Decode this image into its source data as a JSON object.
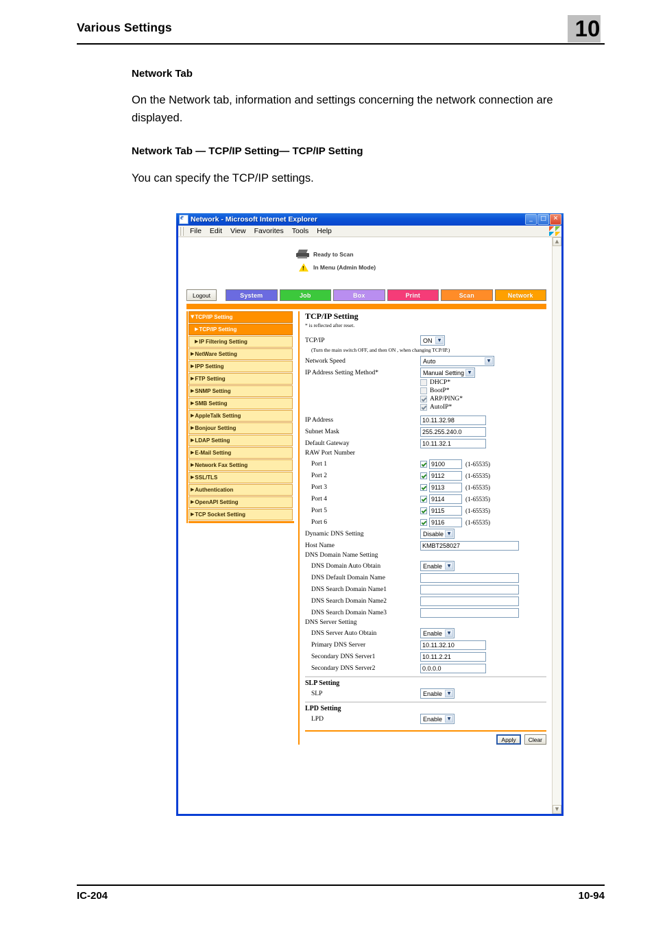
{
  "page": {
    "running_head": "Various Settings",
    "chapter_number": "10",
    "footer_left": "IC-204",
    "footer_right": "10-94"
  },
  "doc": {
    "heading1": "Network Tab",
    "para1": "On the Network tab, information and settings concerning the network connection are displayed.",
    "heading2": "Network Tab — TCP/IP Setting— TCP/IP Setting",
    "para2": "You can specify the TCP/IP settings."
  },
  "browser": {
    "title": "Network - Microsoft Internet Explorer",
    "icon": "ie-document-icon",
    "window_buttons": [
      {
        "name": "minimize",
        "glyph": "_"
      },
      {
        "name": "maximize",
        "glyph": "□"
      },
      {
        "name": "close",
        "glyph": "✕"
      }
    ],
    "menu": [
      "File",
      "Edit",
      "View",
      "Favorites",
      "Tools",
      "Help"
    ]
  },
  "webpage": {
    "status": [
      {
        "icon": "printer-icon",
        "text": "Ready to Scan"
      },
      {
        "icon": "warning-icon",
        "text": "In Menu (Admin Mode)"
      }
    ],
    "logout_label": "Logout",
    "tabs": [
      {
        "label": "System",
        "color": "#6b6be0"
      },
      {
        "label": "Job",
        "color": "#3cc83c"
      },
      {
        "label": "Box",
        "color": "#b98ef0"
      },
      {
        "label": "Print",
        "color": "#f53c78"
      },
      {
        "label": "Scan",
        "color": "#ff8c28"
      },
      {
        "label": "Network",
        "color": "#ffa000"
      }
    ],
    "accent_color": "#ff9000",
    "sidebar": [
      {
        "label": "TCP/IP Setting",
        "state": "group",
        "marker": "▼"
      },
      {
        "label": "TCP/IP Setting",
        "state": "active",
        "marker": "▶",
        "indent": true
      },
      {
        "label": "IP Filtering Setting",
        "state": "normal",
        "marker": "▶",
        "indent": true
      },
      {
        "label": "NetWare Setting",
        "state": "normal",
        "marker": "▶"
      },
      {
        "label": "IPP Setting",
        "state": "normal",
        "marker": "▶"
      },
      {
        "label": "FTP Setting",
        "state": "normal",
        "marker": "▶"
      },
      {
        "label": "SNMP Setting",
        "state": "normal",
        "marker": "▶"
      },
      {
        "label": "SMB Setting",
        "state": "normal",
        "marker": "▶"
      },
      {
        "label": "AppleTalk Setting",
        "state": "normal",
        "marker": "▶"
      },
      {
        "label": "Bonjour Setting",
        "state": "normal",
        "marker": "▶"
      },
      {
        "label": "LDAP Setting",
        "state": "normal",
        "marker": "▶"
      },
      {
        "label": "E-Mail Setting",
        "state": "normal",
        "marker": "▶"
      },
      {
        "label": "Network Fax Setting",
        "state": "normal",
        "marker": "▶"
      },
      {
        "label": "SSL/TLS",
        "state": "normal",
        "marker": "▶"
      },
      {
        "label": "Authentication",
        "state": "normal",
        "marker": "▶"
      },
      {
        "label": "OpenAPI Setting",
        "state": "normal",
        "marker": "▶"
      },
      {
        "label": "TCP Socket Setting",
        "state": "normal",
        "marker": "▶"
      }
    ],
    "content": {
      "title": "TCP/IP Setting",
      "note": "* is reflected after reset.",
      "tcpip_label": "TCP/IP",
      "tcpip_value": "ON",
      "tcpip_hint": "(Turn the main switch OFF, and then ON , when changing TCP/IP.)",
      "network_speed_label": "Network Speed",
      "network_speed_value": "Auto",
      "ip_method_label": "IP Address Setting Method*",
      "ip_method_value": "Manual Setting",
      "ip_method_options": [
        {
          "label": "DHCP*",
          "checked": false,
          "disabled": true
        },
        {
          "label": "BootP*",
          "checked": false,
          "disabled": true
        },
        {
          "label": "ARP/PING*",
          "checked": true,
          "disabled": true
        },
        {
          "label": "AutoIP*",
          "checked": true,
          "disabled": true
        }
      ],
      "ip_address_label": "IP Address",
      "ip_address_value": "10.11.32.98",
      "subnet_label": "Subnet Mask",
      "subnet_value": "255.255.240.0",
      "gateway_label": "Default Gateway",
      "gateway_value": "10.11.32.1",
      "raw_port_label": "RAW Port Number",
      "port_range": "(1-65535)",
      "ports": [
        {
          "label": "Port 1",
          "value": "9100",
          "checked": true
        },
        {
          "label": "Port 2",
          "value": "9112",
          "checked": true
        },
        {
          "label": "Port 3",
          "value": "9113",
          "checked": true
        },
        {
          "label": "Port 4",
          "value": "9114",
          "checked": true
        },
        {
          "label": "Port 5",
          "value": "9115",
          "checked": true
        },
        {
          "label": "Port 6",
          "value": "9116",
          "checked": true
        }
      ],
      "dyndns_label": "Dynamic DNS Setting",
      "dyndns_value": "Disable",
      "hostname_label": "Host Name",
      "hostname_value": "KMBT258027",
      "dns_domain_section": "DNS Domain Name Setting",
      "dns_domain_auto_label": "DNS Domain Auto Obtain",
      "dns_domain_auto_value": "Enable",
      "dns_default_domain_label": "DNS Default Domain Name",
      "dns_default_domain_value": "",
      "dns_search1_label": "DNS Search Domain Name1",
      "dns_search1_value": "",
      "dns_search2_label": "DNS Search Domain Name2",
      "dns_search2_value": "",
      "dns_search3_label": "DNS Search Domain Name3",
      "dns_search3_value": "",
      "dns_server_section": "DNS Server Setting",
      "dns_server_auto_label": "DNS Server Auto Obtain",
      "dns_server_auto_value": "Enable",
      "primary_dns_label": "Primary DNS Server",
      "primary_dns_value": "10.11.32.10",
      "secondary_dns1_label": "Secondary DNS Server1",
      "secondary_dns1_value": "10.11.2.21",
      "secondary_dns2_label": "Secondary DNS Server2",
      "secondary_dns2_value": "0.0.0.0",
      "slp_section": "SLP Setting",
      "slp_label": "SLP",
      "slp_value": "Enable",
      "lpd_section": "LPD Setting",
      "lpd_label": "LPD",
      "lpd_value": "Enable",
      "apply_label": "Apply",
      "clear_label": "Clear"
    }
  }
}
